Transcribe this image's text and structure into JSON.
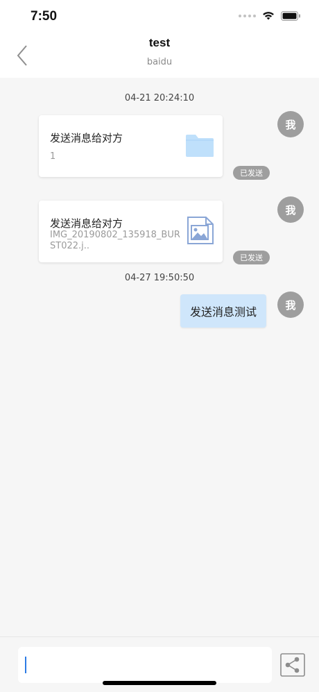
{
  "status_bar": {
    "time": "7:50"
  },
  "header": {
    "title": "test",
    "subtitle": "baidu"
  },
  "messages": [
    {
      "timestamp": "04-21 20:24:10"
    },
    {
      "type": "file",
      "title": "发送消息给对方",
      "subtitle": "1",
      "icon": "folder-icon",
      "avatar": "我",
      "status": "已发送"
    },
    {
      "type": "file",
      "title": "发送消息给对方",
      "subtitle": "IMG_20190802_135918_BURST022.j..",
      "icon": "image-file-icon",
      "avatar": "我",
      "status": "已发送"
    },
    {
      "timestamp": "04-27 19:50:50"
    },
    {
      "type": "text",
      "text": "发送消息测试",
      "avatar": "我"
    }
  ],
  "colors": {
    "background": "#f6f6f6",
    "bubble": "#cfe6fb",
    "avatar": "#9e9e9e",
    "folder": "#bfe0fb",
    "caret": "#2c7be5"
  },
  "input": {
    "value": ""
  }
}
